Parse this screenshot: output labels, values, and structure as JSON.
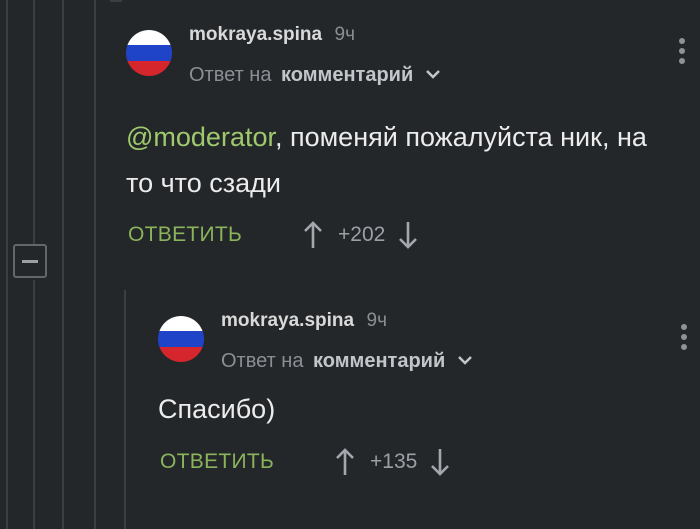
{
  "comments": [
    {
      "username": "mokraya.spina",
      "time": "9ч",
      "reply_prefix": "Ответ на",
      "reply_link": "комментарий",
      "mention": "@moderator",
      "text": ", поменяй пожалуйста ник, на то что сзади",
      "reply_button": "ОТВЕТИТЬ",
      "rating": "+202"
    },
    {
      "username": "mokraya.spina",
      "time": "9ч",
      "reply_prefix": "Ответ на",
      "reply_link": "комментарий",
      "text": "Спасибо)",
      "reply_button": "ОТВЕТИТЬ",
      "rating": "+135"
    }
  ],
  "icons": {
    "avatar": "russian-flag-avatar",
    "collapse": "minus-collapse-icon",
    "upvote": "arrow-up-icon",
    "downvote": "arrow-down-icon",
    "menu": "more-vertical-icon",
    "reply_dropdown": "chevron-down-icon"
  },
  "colors": {
    "background": "#24272a",
    "accent_green": "#8ab35b",
    "mention_green": "#9ec96c",
    "flag_white": "#ffffff",
    "flag_blue": "#1f44c8",
    "flag_red": "#d5262d"
  }
}
